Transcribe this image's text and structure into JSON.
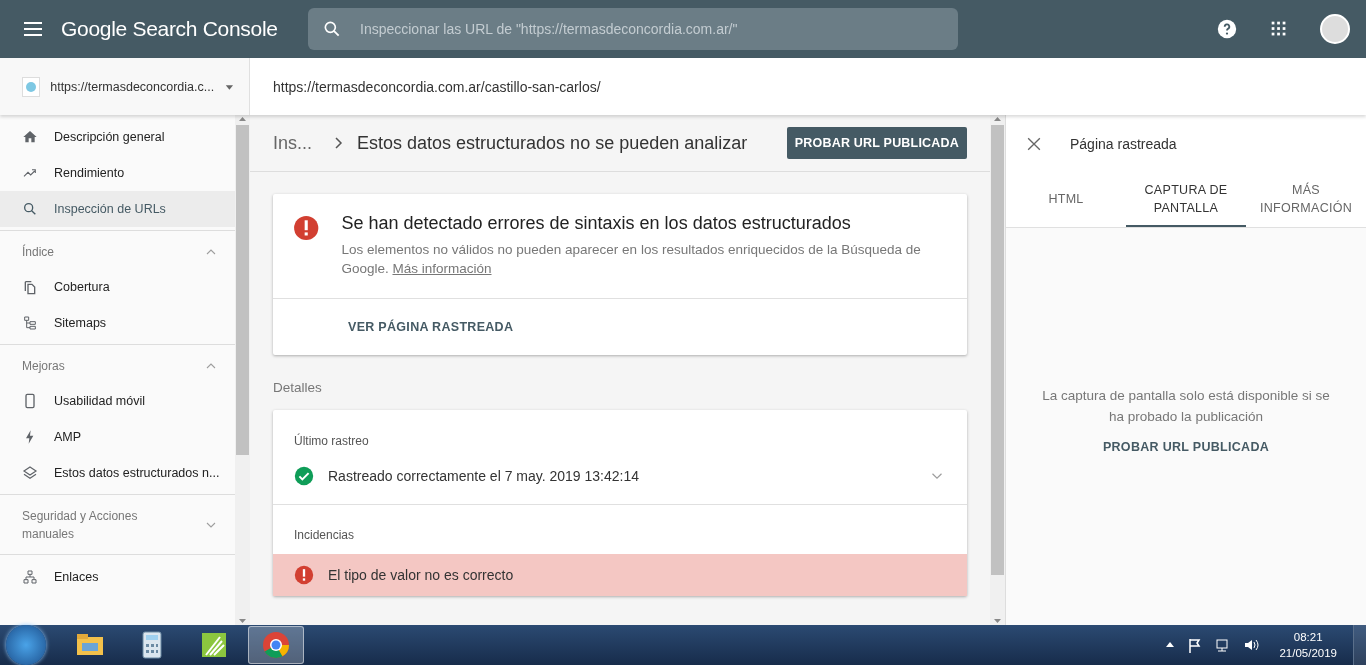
{
  "topbar": {
    "product": "Google Search Console",
    "search_placeholder": "Inspeccionar las URL de \"https://termasdeconcordia.com.ar/\""
  },
  "property": {
    "label": "https://termasdeconcordia.c..."
  },
  "inspected_url": "https://termasdeconcordia.com.ar/castillo-san-carlos/",
  "sidebar": {
    "sections": [
      {
        "items": [
          {
            "label": "Descripción general",
            "selected": false
          },
          {
            "label": "Rendimiento",
            "selected": false
          },
          {
            "label": "Inspección de URLs",
            "selected": true
          }
        ]
      },
      {
        "heading": "Índice",
        "expanded": true,
        "items": [
          {
            "label": "Cobertura",
            "selected": false
          },
          {
            "label": "Sitemaps",
            "selected": false
          }
        ]
      },
      {
        "heading": "Mejoras",
        "expanded": true,
        "items": [
          {
            "label": "Usabilidad móvil",
            "selected": false
          },
          {
            "label": "AMP",
            "selected": false
          },
          {
            "label": "Estos datos estructurados n...",
            "selected": false
          }
        ]
      },
      {
        "heading": "Seguridad y Acciones manuales",
        "expanded": false
      },
      {
        "items": [
          {
            "label": "Enlaces",
            "selected": false
          }
        ]
      }
    ]
  },
  "breadcrumb": [
    "Ins...",
    "Estos datos estructurados no se pueden analizar"
  ],
  "test_button": "PROBAR URL PUBLICADA",
  "alert": {
    "title": "Se han detectado errores de sintaxis en los datos estructurados",
    "body": "Los elementos no válidos no pueden aparecer en los resultados enriquecidos de la Búsqueda de Google.",
    "link": "Más información",
    "action": "VER PÁGINA RASTREADA"
  },
  "details": {
    "heading": "Detalles",
    "last_crawl_label": "Último rastreo",
    "last_crawl": "Rastreado correctamente el 7 may. 2019 13:42:14",
    "expanded": false,
    "incidents_label": "Incidencias",
    "incidents": [
      "El tipo de valor no es correcto"
    ]
  },
  "panel": {
    "title": "Página rastreada",
    "tabs": [
      {
        "label": "HTML",
        "selected": false
      },
      {
        "label": "CAPTURA DE PANTALLA",
        "selected": true
      },
      {
        "label": "MÁS INFORMACIÓN",
        "selected": false
      }
    ],
    "message": "La captura de pantalla solo está disponible si se ha probado la publicación",
    "button": "PROBAR URL PUBLICADA"
  },
  "taskbar": {
    "apps": [
      {
        "kind": "folder",
        "selected": false
      },
      {
        "kind": "calculator",
        "selected": false
      },
      {
        "kind": "pen",
        "selected": false
      },
      {
        "kind": "browser",
        "selected": true
      }
    ],
    "time": "08:21",
    "date": "21/05/2019"
  }
}
